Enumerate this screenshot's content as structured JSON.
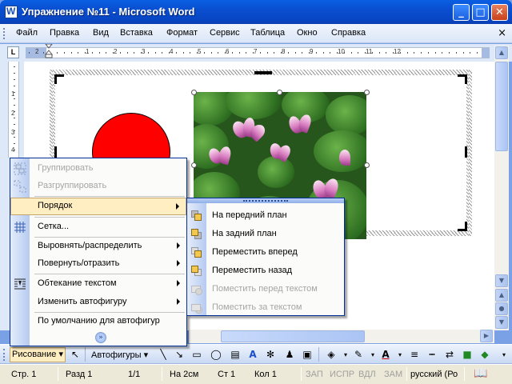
{
  "window": {
    "title": "Упражнение №11 - Microsoft Word",
    "minimize": "_",
    "maximize": "□",
    "close": "✕"
  },
  "menubar": {
    "items": [
      "Файл",
      "Правка",
      "Вид",
      "Вставка",
      "Формат",
      "Сервис",
      "Таблица",
      "Окно",
      "Справка"
    ],
    "close_doc": "×"
  },
  "ruler": {
    "tab_selector": "L",
    "numbers": [
      "1",
      "2",
      "1",
      "2",
      "3",
      "4",
      "5",
      "6",
      "7",
      "8",
      "9",
      "10",
      "11",
      "12"
    ],
    "vertical_numbers": [
      "1",
      "2",
      "3",
      "4"
    ]
  },
  "drawing_menu": {
    "items": [
      {
        "label": "Группировать",
        "enabled": false,
        "icon": "group-icon"
      },
      {
        "label": "Разгруппировать",
        "enabled": false,
        "icon": "ungroup-icon"
      },
      {
        "label": "Порядок",
        "enabled": true,
        "submenu": true,
        "active": true
      },
      {
        "label": "Сетка...",
        "enabled": true,
        "icon": "grid-icon"
      },
      {
        "label": "Выровнять/распределить",
        "enabled": true,
        "submenu": true
      },
      {
        "label": "Повернуть/отразить",
        "enabled": true,
        "submenu": true
      },
      {
        "label": "Обтекание текстом",
        "enabled": true,
        "submenu": true,
        "icon": "text-wrap-icon"
      },
      {
        "label": "Изменить автофигуру",
        "enabled": true,
        "submenu": true
      },
      {
        "label": "По умолчанию для автофигур",
        "enabled": true
      }
    ],
    "expand": "»"
  },
  "order_submenu": {
    "items": [
      {
        "label": "На передний план",
        "enabled": true,
        "icon": "bring-to-front-icon"
      },
      {
        "label": "На задний план",
        "enabled": true,
        "icon": "send-to-back-icon"
      },
      {
        "label": "Переместить вперед",
        "enabled": true,
        "icon": "bring-forward-icon"
      },
      {
        "label": "Переместить назад",
        "enabled": true,
        "icon": "send-backward-icon"
      },
      {
        "label": "Поместить перед текстом",
        "enabled": false,
        "icon": "in-front-of-text-icon"
      },
      {
        "label": "Поместить за текстом",
        "enabled": false,
        "icon": "behind-text-icon"
      }
    ]
  },
  "drawing_toolbar": {
    "draw_label": "Рисование ▾",
    "autoshapes_label": "Автофигуры ▾"
  },
  "statusbar": {
    "page": "Стр. 1",
    "section": "Разд 1",
    "pages": "1/1",
    "at": "На 2см",
    "line": "Ст 1",
    "col": "Кол 1",
    "rec": "ЗАП",
    "trk": "ИСПР",
    "ext": "ВДЛ",
    "ovr": "ЗАМ",
    "language": "русский (Ро"
  },
  "colors": {
    "title_blue": "#0a4ed0",
    "circle_red": "#ff0000",
    "menu_highlight": "#ffeec2"
  }
}
